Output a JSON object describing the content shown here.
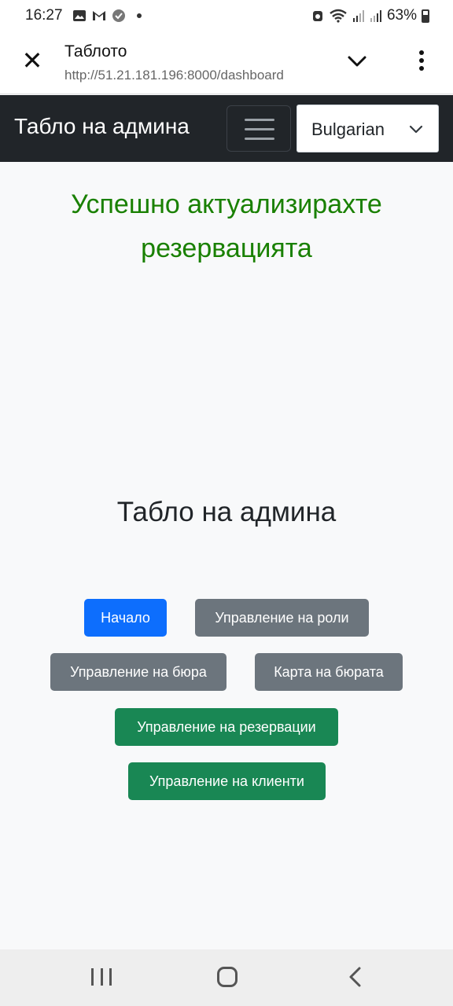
{
  "status_bar": {
    "time": "16:27",
    "battery": "63%",
    "icons": [
      "image-icon",
      "gmail-icon",
      "check-circle-icon",
      "dot-icon",
      "alarm-icon",
      "wifi-icon",
      "signal-icon",
      "signal-icon-2",
      "battery-icon"
    ]
  },
  "browser": {
    "title": "Таблото",
    "url": "http://51.21.181.196:8000/dashboard"
  },
  "navbar": {
    "brand": "Табло на админа",
    "language": "Bulgarian"
  },
  "main": {
    "success_message": "Успешно актуализирахте резервацията",
    "title": "Табло на админа",
    "buttons": {
      "home": "Начало",
      "manage_roles": "Управление на роли",
      "manage_offices": "Управление на бюра",
      "offices_map": "Карта на бюрата",
      "manage_reservations": "Управление на резервации",
      "manage_clients": "Управление на клиенти"
    }
  },
  "colors": {
    "navbar": "#212529",
    "success_text": "#198000",
    "primary": "#0d6efd",
    "secondary": "#6c757d",
    "success": "#198754"
  }
}
